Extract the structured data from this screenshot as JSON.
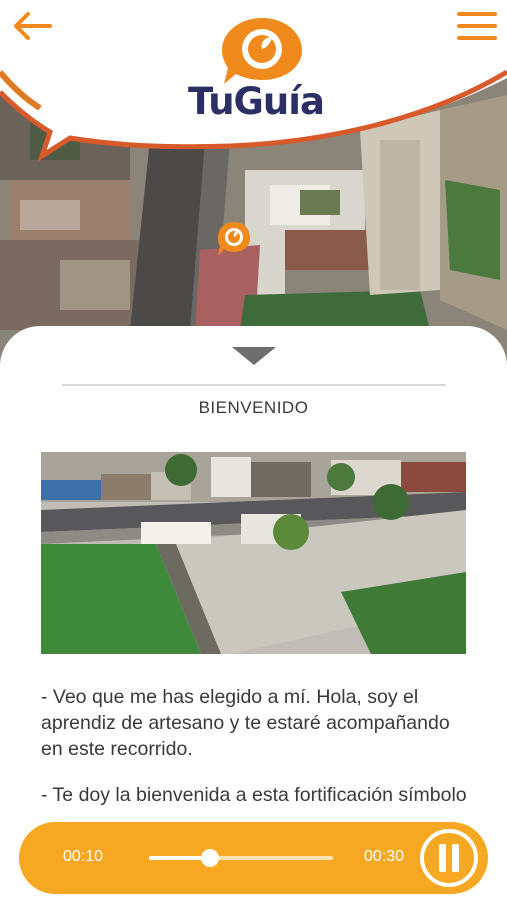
{
  "app": {
    "logo_text": "TuGuía",
    "brand_orange": "#f08a1c",
    "brand_navy": "#2b2f63",
    "player_color": "#f7a823"
  },
  "header": {
    "back_icon": "arrow-left-icon",
    "menu_icon": "hamburger-menu-icon"
  },
  "map": {
    "marker_icon": "location-pin-icon"
  },
  "sheet": {
    "collapse_icon": "triangle-down-icon",
    "title": "BIENVENIDO",
    "paragraphs": [
      "- Veo que me has elegido a mí. Hola, soy el aprendiz de artesano y te estaré acompañando en este recorrido.",
      "- Te doy la bienvenida a esta fortificación símbolo de la mejor arquitectura y mano de"
    ]
  },
  "player": {
    "current_time": "00:10",
    "total_time": "00:30",
    "progress": 0.3333,
    "pause_icon": "pause-icon"
  }
}
